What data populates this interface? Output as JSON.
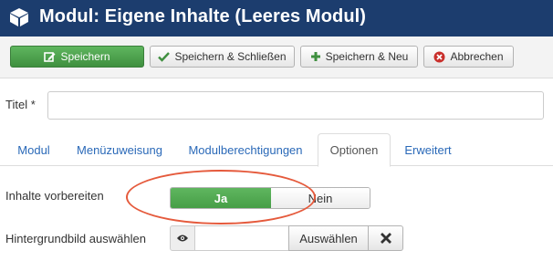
{
  "header": {
    "title": "Modul: Eigene Inhalte (Leeres Modul)",
    "icon": "cube-icon"
  },
  "toolbar": {
    "save": {
      "label": "Speichern",
      "icon": "edit-icon"
    },
    "save_close": {
      "label": "Speichern & Schließen",
      "icon": "check-icon"
    },
    "save_new": {
      "label": "Speichern & Neu",
      "icon": "plus-icon"
    },
    "cancel": {
      "label": "Abbrechen",
      "icon": "cancel-circle-icon"
    }
  },
  "form": {
    "title_label": "Titel *",
    "title_value": ""
  },
  "tabs": [
    {
      "label": "Modul",
      "active": false
    },
    {
      "label": "Menüzuweisung",
      "active": false
    },
    {
      "label": "Modulberechtigungen",
      "active": false
    },
    {
      "label": "Optionen",
      "active": true
    },
    {
      "label": "Erweitert",
      "active": false
    }
  ],
  "options": {
    "prepare_content_label": "Inhalte vorbereiten",
    "prepare_content_yes": "Ja",
    "prepare_content_no": "Nein",
    "prepare_content_value": "Ja",
    "background_label": "Hintergrundbild auswählen",
    "background_value": "",
    "background_choose": "Auswählen",
    "background_clear_icon": "times-icon",
    "background_preview_icon": "eye-icon"
  },
  "colors": {
    "header_bg": "#1c3d6e",
    "primary_green": "#46a546",
    "tab_link": "#2a69b8",
    "highlight_ellipse": "#e55a3c",
    "cancel_red": "#c9302c"
  }
}
